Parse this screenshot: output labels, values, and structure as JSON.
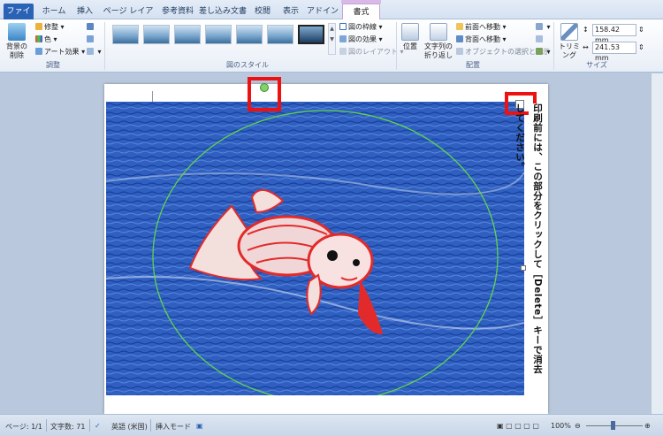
{
  "tabs": [
    {
      "label": "ファイル"
    },
    {
      "label": "ホーム"
    },
    {
      "label": "挿入"
    },
    {
      "label": "ページ レイアウト"
    },
    {
      "label": "参考資料"
    },
    {
      "label": "差し込み文書"
    },
    {
      "label": "校閲"
    },
    {
      "label": "表示"
    },
    {
      "label": "アドイン"
    },
    {
      "label": "書式"
    }
  ],
  "ribbon": {
    "adjust": {
      "remove_bg": "背景の削除",
      "correct": "修整",
      "color": "色",
      "art": "アート効果",
      "group_label": "調整"
    },
    "styles": {
      "border": "図の枠線",
      "effect": "図の効果",
      "layout": "図のレイアウト",
      "group_label": "図のスタイル"
    },
    "arrange": {
      "position": "位置",
      "wrap": "文字列の折り返し",
      "bring_forward": "前面へ移動",
      "send_backward": "背面へ移動",
      "selection_pane": "オブジェクトの選択と表示",
      "group_label": "配置"
    },
    "size": {
      "crop": "トリミング",
      "height": "158.42 mm",
      "width": "241.53 mm",
      "group_label": "サイズ"
    }
  },
  "caption": "印刷前には、この部分をクリックして［Delete］キーで消去してください。",
  "status": {
    "page": "ページ: 1/1",
    "words": "文字数: 71",
    "language": "英語 (米国)",
    "mode": "挿入モード",
    "zoom": "100%"
  },
  "colors": {
    "accent": "#2a62b6",
    "highlight": "#ee1111",
    "picture_bg": "#2756b8"
  }
}
